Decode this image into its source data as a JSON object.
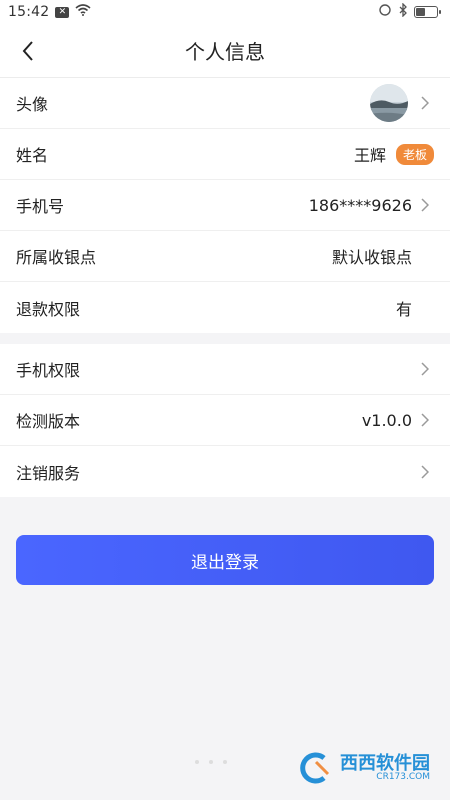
{
  "status_bar": {
    "time": "15:42",
    "notification_badge": "✕"
  },
  "header": {
    "title": "个人信息"
  },
  "profile": {
    "avatar_label": "头像",
    "name_label": "姓名",
    "name_value": "王辉",
    "role_badge": "老板",
    "phone_label": "手机号",
    "phone_value": "186****9626",
    "store_label": "所属收银点",
    "store_value": "默认收银点",
    "refund_label": "退款权限",
    "refund_value": "有"
  },
  "settings": {
    "permissions_label": "手机权限",
    "version_label": "检测版本",
    "version_value": "v1.0.0",
    "cancel_label": "注销服务"
  },
  "actions": {
    "logout_label": "退出登录"
  },
  "watermark": {
    "main": "西西软件园",
    "sub": "CR173.COM"
  },
  "colors": {
    "primary": "#4a66ff",
    "badge": "#f08a3a",
    "background": "#f4f4f6"
  }
}
